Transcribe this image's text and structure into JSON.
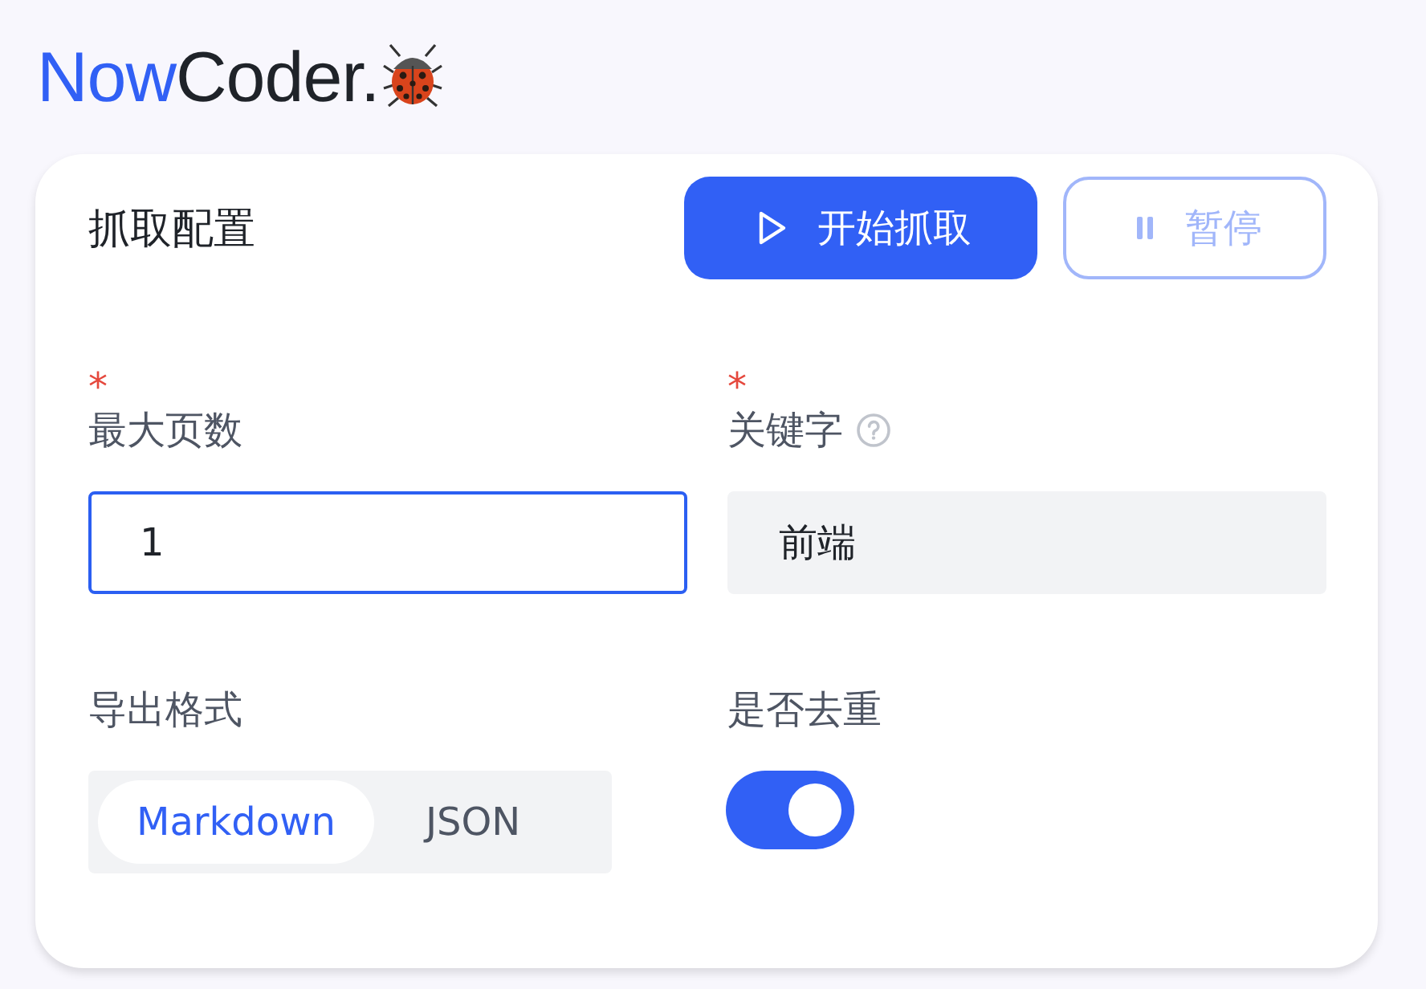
{
  "logo": {
    "accent": "Now",
    "rest": "Coder."
  },
  "card": {
    "title": "抓取配置",
    "buttons": [
      {
        "label": "开始抓取",
        "kind": "start",
        "disabled": false
      },
      {
        "label": "暂停",
        "kind": "pause",
        "disabled": true
      }
    ],
    "fields": [
      {
        "label": "最大页数",
        "required_mark": "*",
        "help": false,
        "kind": "input",
        "value": "1",
        "focused": true
      },
      {
        "label": "关键字",
        "required_mark": "*",
        "help": true,
        "kind": "input",
        "value": "前端",
        "focused": false
      },
      {
        "label": "导出格式",
        "kind": "segmented",
        "options": [
          {
            "label": "Markdown",
            "selected": true
          },
          {
            "label": "JSON",
            "selected": false
          }
        ]
      },
      {
        "label": "是否去重",
        "kind": "switch",
        "on": true
      }
    ]
  }
}
